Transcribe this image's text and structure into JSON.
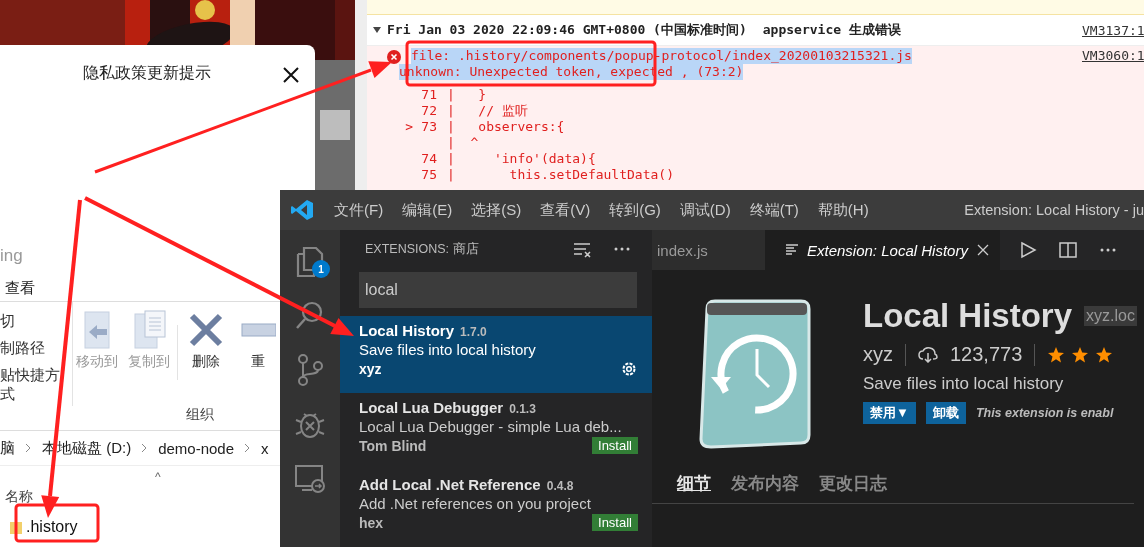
{
  "privacy_dialog": {
    "title": "隐私政策更新提示"
  },
  "devtools": {
    "log_header": {
      "timestamp": "Fri Jan 03 2020 22:09:46 GMT+0800 (中国标准时间)",
      "source": "appservice 生成错误",
      "link": "VM3137:1"
    },
    "error": {
      "lines": [
        "file: .history/components/popup-protocol/index_20200103215321.js",
        "unknown: Unexpected token, expected , (73:2)"
      ],
      "link": "VM3060:1"
    },
    "code_frame": [
      {
        "number": "71",
        "code": "|   }"
      },
      {
        "number": "72",
        "code": "|   // 监听"
      },
      {
        "marker": ">",
        "number": "73",
        "code": "|   observers:{"
      },
      {
        "code": "|  ^"
      },
      {
        "number": "74",
        "code": "|     'info'(data){"
      },
      {
        "number": "75",
        "code": "|       this.setDefaultData()"
      }
    ]
  },
  "file_explorer": {
    "title": "ing",
    "tab": "查看",
    "clipboard": [
      "切",
      "制路径",
      "贴快捷方式"
    ],
    "ribbon_buttons": [
      {
        "kind": "move",
        "label": "移动到",
        "disabled": true
      },
      {
        "kind": "copy",
        "label": "复制到",
        "disabled": true
      },
      {
        "kind": "delete",
        "label": "删除",
        "disabled": false
      },
      {
        "kind": "rename",
        "label": "重",
        "disabled": false
      }
    ],
    "group": "组织",
    "breadcrumb": [
      "脑",
      "本地磁盘 (D:)",
      "demo-node",
      "x"
    ],
    "column": "名称",
    "sort_caret": "^",
    "files": [
      {
        "name": ".history"
      }
    ]
  },
  "vscode": {
    "menu": [
      "文件(F)",
      "编辑(E)",
      "选择(S)",
      "查看(V)",
      "转到(G)",
      "调试(D)",
      "终端(T)",
      "帮助(H)"
    ],
    "window_title": "Extension: Local History - ju",
    "badge": "1",
    "sidebar": {
      "title": "EXTENSIONS: 商店",
      "search": "local",
      "extensions": [
        {
          "name": "Local History",
          "version": "1.7.0",
          "description": "Save files into local history",
          "publisher": "xyz",
          "selected": true,
          "kind": "installed"
        },
        {
          "name": "Local Lua Debugger",
          "version": "0.1.3",
          "description": "Local Lua Debugger - simple Lua deb...",
          "publisher": "Tom Blind",
          "selected": false,
          "kind": "available",
          "action": "Install"
        },
        {
          "name": "Add Local .Net Reference",
          "version": "0.4.8",
          "description": "Add .Net references on you project",
          "publisher": "hex",
          "selected": false,
          "kind": "available",
          "action": "Install"
        }
      ]
    },
    "tabs": [
      {
        "label": "index.js",
        "selected": false
      },
      {
        "label": "Extension: Local History",
        "selected": true
      }
    ],
    "detail": {
      "name": "Local History",
      "id": "xyz.loc",
      "publisher": "xyz",
      "installs": "123,773",
      "stars": 3,
      "description": "Save files into local history",
      "buttons": [
        "禁用▼",
        "卸载"
      ],
      "status": "This extension is enabl",
      "tabs": [
        {
          "label": "细节",
          "selected": true
        },
        {
          "label": "发布内容",
          "selected": false
        },
        {
          "label": "更改日志",
          "selected": false
        }
      ]
    }
  }
}
